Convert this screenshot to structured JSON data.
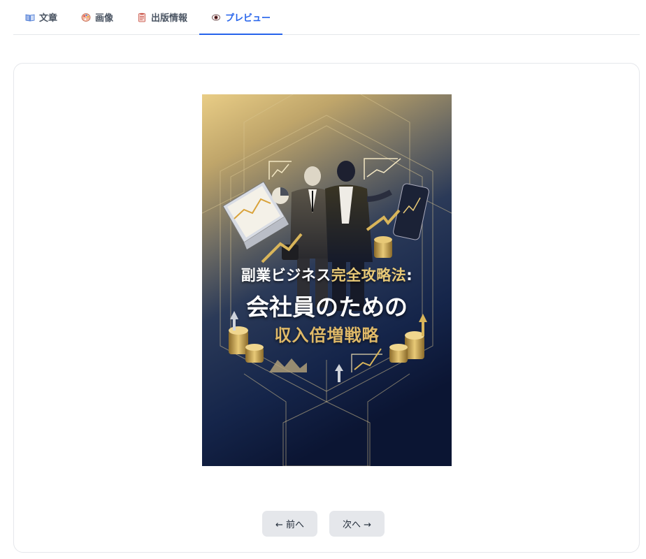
{
  "tabs": [
    {
      "label": "文章",
      "icon": "book-icon",
      "active": false
    },
    {
      "label": "画像",
      "icon": "palette-icon",
      "active": false
    },
    {
      "label": "出版情報",
      "icon": "clipboard-icon",
      "active": false
    },
    {
      "label": "プレビュー",
      "icon": "eye-icon",
      "active": true
    }
  ],
  "colors": {
    "accent": "#2563eb",
    "button_bg": "#e5e7eb",
    "cover_gold": "#e8c977",
    "cover_navy": "#0f1d3d"
  },
  "cover": {
    "title_line1_part1": "副業ビジネス",
    "title_line1_part2": "完全攻略法",
    "title_line1_colon": ":",
    "title_line2": "会社員のための",
    "title_line3": "収入倍増戦略"
  },
  "nav": {
    "prev_label": "← 前へ",
    "next_label": "次へ →"
  }
}
